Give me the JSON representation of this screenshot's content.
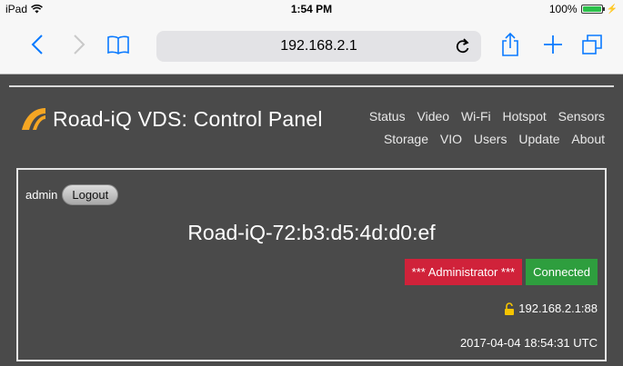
{
  "status_bar": {
    "device": "iPad",
    "time": "1:54 PM",
    "battery": "100%",
    "battery_level": 1.0
  },
  "browser": {
    "url": "192.168.2.1"
  },
  "app": {
    "title": "Road-iQ VDS: Control Panel",
    "nav": [
      "Status",
      "Video",
      "Wi-Fi",
      "Hotspot",
      "Sensors",
      "Storage",
      "VIO",
      "Users",
      "Update",
      "About"
    ]
  },
  "panel": {
    "username": "admin",
    "logout_label": "Logout",
    "device_name": "Road-iQ-72:b3:d5:4d:d0:ef",
    "role_badge": "*** Administrator ***",
    "connection_badge": "Connected",
    "ip_port": "192.168.2.1:88",
    "timestamp": "2017-04-04 18:54:31 UTC"
  },
  "colors": {
    "page_bg": "#4a4a4a",
    "admin_badge": "#d0223a",
    "connected_badge": "#2e9e3e",
    "logo": "#f5a623",
    "ios_blue": "#0a7aff"
  },
  "icons": {
    "wifi": "wifi-icon",
    "back": "back-chevron-icon",
    "forward": "forward-chevron-icon",
    "bookmarks": "book-icon",
    "reload": "reload-icon",
    "share": "share-icon",
    "add": "plus-icon",
    "tabs": "tabs-icon",
    "lock": "unlocked-padlock-icon"
  }
}
